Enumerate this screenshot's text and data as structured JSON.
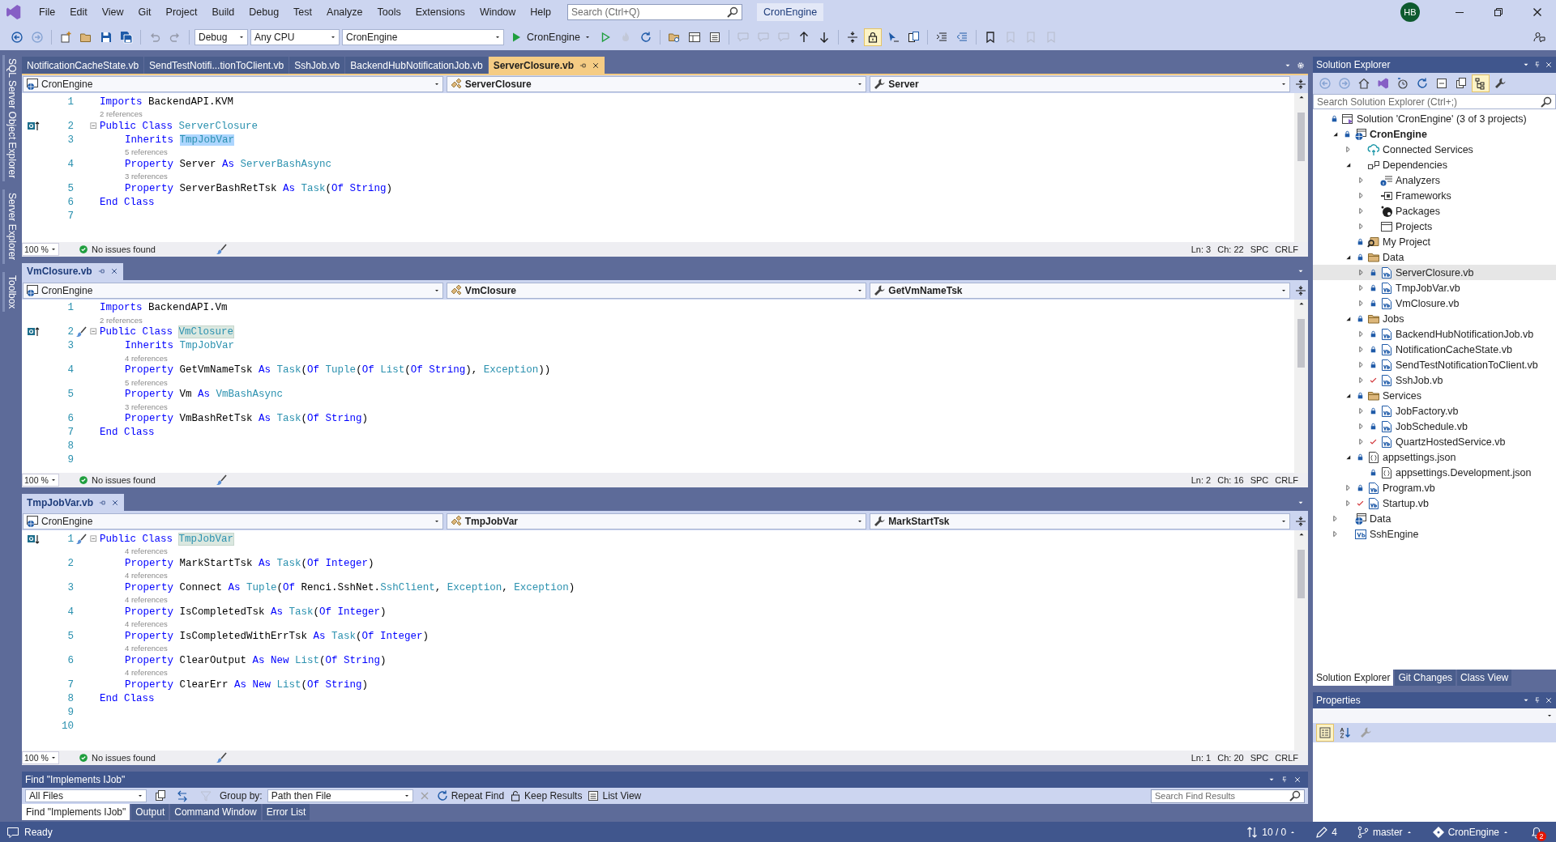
{
  "title_bar": {
    "menu": [
      "File",
      "Edit",
      "View",
      "Git",
      "Project",
      "Build",
      "Debug",
      "Test",
      "Analyze",
      "Tools",
      "Extensions",
      "Window",
      "Help"
    ],
    "search": {
      "placeholder": "Search (Ctrl+Q)"
    },
    "solution_name": "CronEngine",
    "account": {
      "initials": "HB"
    }
  },
  "toolbar": {
    "left_buttons": [
      {
        "disabled": false
      },
      {
        "disabled": true
      },
      {
        "disabled": false
      },
      {
        "disabled": false
      },
      {
        "disabled": false
      },
      {
        "disabled": false
      },
      {
        "disabled": true
      },
      {
        "disabled": true
      }
    ],
    "configuration": "Debug",
    "platform": "Any CPU",
    "startup_project": "CronEngine",
    "run_label": "CronEngine",
    "right_buttons": [
      {
        "pressed": false,
        "disabled": false
      },
      {
        "pressed": false,
        "disabled": true
      },
      {
        "pressed": false,
        "disabled": false
      },
      {
        "pressed": false,
        "disabled": false
      },
      {
        "pressed": false,
        "disabled": false
      },
      {
        "pressed": false,
        "disabled": false
      },
      {
        "pressed": false,
        "disabled": true
      },
      {
        "pressed": false,
        "disabled": true
      },
      {
        "pressed": false,
        "disabled": true
      },
      {
        "pressed": false,
        "disabled": false
      },
      {
        "pressed": false,
        "disabled": false
      },
      {
        "pressed": false,
        "disabled": false
      },
      {
        "pressed": true,
        "disabled": false
      },
      {
        "pressed": false,
        "disabled": false
      },
      {
        "pressed": false,
        "disabled": false
      },
      {
        "pressed": false,
        "disabled": false
      },
      {
        "pressed": false,
        "disabled": false
      },
      {
        "pressed": false,
        "disabled": false
      },
      {
        "pressed": false,
        "disabled": true
      },
      {
        "pressed": false,
        "disabled": true
      },
      {
        "pressed": false,
        "disabled": true
      }
    ]
  },
  "side_tabs": [
    "SQL Server Object Explorer",
    "Server Explorer",
    "Toolbox"
  ],
  "panes": [
    {
      "focused": true,
      "tabs": [
        {
          "label": "NotificationCacheState.vb",
          "selected": false
        },
        {
          "label": "SendTestNotifi...tionToClient.vb",
          "selected": false
        },
        {
          "label": "SshJob.vb",
          "selected": false
        },
        {
          "label": "BackendHubNotificationJob.vb",
          "selected": false
        },
        {
          "label": "ServerClosure.vb",
          "selected": true
        }
      ],
      "nav": {
        "project": "CronEngine",
        "type": "ServerClosure",
        "member": "Server"
      },
      "lines": [
        {
          "number": "1",
          "kind": "top",
          "tokens": [
            {
              "kind": "kw",
              "text": "Imports "
            },
            {
              "kind": "plain",
              "text": "BackendAPI.KVM"
            }
          ]
        },
        {
          "number": "2",
          "kind": "top",
          "codelens": "2 references",
          "glyph": {
            "kind": "up"
          },
          "fold": true,
          "tokens": [
            {
              "kind": "kw",
              "text": "Public Class "
            },
            {
              "kind": "type",
              "text": "ServerClosure"
            }
          ]
        },
        {
          "number": "3",
          "kind": "member",
          "tokens": [
            {
              "kind": "kw",
              "text": "Inherits "
            },
            {
              "kind": "type-selected",
              "text": "TmpJobVar"
            }
          ]
        },
        {
          "number": "4",
          "kind": "member",
          "codelens": "5 references",
          "tokens": [
            {
              "kind": "kw",
              "text": "Property "
            },
            {
              "kind": "plain",
              "text": "Server "
            },
            {
              "kind": "kw",
              "text": "As "
            },
            {
              "kind": "type",
              "text": "ServerBashAsync"
            }
          ]
        },
        {
          "number": "5",
          "kind": "member",
          "codelens": "3 references",
          "tokens": [
            {
              "kind": "kw",
              "text": "Property "
            },
            {
              "kind": "plain",
              "text": "ServerBashRetTsk "
            },
            {
              "kind": "kw",
              "text": "As "
            },
            {
              "kind": "type",
              "text": "Task"
            },
            {
              "kind": "plain",
              "text": "("
            },
            {
              "kind": "kw",
              "text": "Of String"
            },
            {
              "kind": "plain",
              "text": ")"
            }
          ]
        },
        {
          "number": "6",
          "kind": "top",
          "tokens": [
            {
              "kind": "kw",
              "text": "End Class"
            }
          ]
        },
        {
          "number": "7",
          "kind": "top"
        }
      ],
      "status": {
        "zoom": "100 %",
        "issues": "No issues found",
        "line": "Ln: 3",
        "column": "Ch: 22",
        "whitespace": "SPC",
        "line_ending": "CRLF"
      }
    },
    {
      "focused": false,
      "tabs": [
        {
          "label": "VmClosure.vb",
          "selected": true
        }
      ],
      "nav": {
        "project": "CronEngine",
        "type": "VmClosure",
        "member": "GetVmNameTsk"
      },
      "lines": [
        {
          "number": "1",
          "kind": "top",
          "tokens": [
            {
              "kind": "kw",
              "text": "Imports "
            },
            {
              "kind": "plain",
              "text": "BackendAPI.Vm"
            }
          ]
        },
        {
          "number": "2",
          "kind": "top",
          "codelens": "2 references",
          "glyph": {
            "kind": "up"
          },
          "quick_action": true,
          "fold": true,
          "tokens": [
            {
              "kind": "kw",
              "text": "Public Class "
            },
            {
              "kind": "type-ref",
              "text": "VmClosure"
            }
          ]
        },
        {
          "number": "3",
          "kind": "member",
          "tokens": [
            {
              "kind": "kw",
              "text": "Inherits "
            },
            {
              "kind": "type",
              "text": "TmpJobVar"
            }
          ]
        },
        {
          "number": "4",
          "kind": "member",
          "codelens": "4 references",
          "tokens": [
            {
              "kind": "kw",
              "text": "Property "
            },
            {
              "kind": "plain",
              "text": "GetVmNameTsk "
            },
            {
              "kind": "kw",
              "text": "As "
            },
            {
              "kind": "type",
              "text": "Task"
            },
            {
              "kind": "plain",
              "text": "("
            },
            {
              "kind": "kw",
              "text": "Of "
            },
            {
              "kind": "type",
              "text": "Tuple"
            },
            {
              "kind": "plain",
              "text": "("
            },
            {
              "kind": "kw",
              "text": "Of "
            },
            {
              "kind": "type",
              "text": "List"
            },
            {
              "kind": "plain",
              "text": "("
            },
            {
              "kind": "kw",
              "text": "Of String"
            },
            {
              "kind": "plain",
              "text": "), "
            },
            {
              "kind": "type",
              "text": "Exception"
            },
            {
              "kind": "plain",
              "text": "))"
            }
          ]
        },
        {
          "number": "5",
          "kind": "member",
          "codelens": "5 references",
          "tokens": [
            {
              "kind": "kw",
              "text": "Property "
            },
            {
              "kind": "plain",
              "text": "Vm "
            },
            {
              "kind": "kw",
              "text": "As "
            },
            {
              "kind": "type",
              "text": "VmBashAsync"
            }
          ]
        },
        {
          "number": "6",
          "kind": "member",
          "codelens": "3 references",
          "tokens": [
            {
              "kind": "kw",
              "text": "Property "
            },
            {
              "kind": "plain",
              "text": "VmBashRetTsk "
            },
            {
              "kind": "kw",
              "text": "As "
            },
            {
              "kind": "type",
              "text": "Task"
            },
            {
              "kind": "plain",
              "text": "("
            },
            {
              "kind": "kw",
              "text": "Of String"
            },
            {
              "kind": "plain",
              "text": ")"
            }
          ]
        },
        {
          "number": "7",
          "kind": "top",
          "tokens": [
            {
              "kind": "kw",
              "text": "End Class"
            }
          ]
        },
        {
          "number": "8",
          "kind": "top"
        },
        {
          "number": "9",
          "kind": "top"
        }
      ],
      "status": {
        "zoom": "100 %",
        "issues": "No issues found",
        "line": "Ln: 2",
        "column": "Ch: 16",
        "whitespace": "SPC",
        "line_ending": "CRLF"
      }
    },
    {
      "focused": false,
      "tabs": [
        {
          "label": "TmpJobVar.vb",
          "selected": true
        }
      ],
      "nav": {
        "project": "CronEngine",
        "type": "TmpJobVar",
        "member": "MarkStartTsk"
      },
      "lines": [
        {
          "number": "1",
          "kind": "top",
          "glyph": {
            "kind": "down"
          },
          "quick_action": true,
          "fold": true,
          "tokens": [
            {
              "kind": "kw",
              "text": "Public Class "
            },
            {
              "kind": "type-ref",
              "text": "TmpJobVar"
            }
          ]
        },
        {
          "number": "2",
          "kind": "member",
          "codelens": "4 references",
          "tokens": [
            {
              "kind": "kw",
              "text": "Property "
            },
            {
              "kind": "plain",
              "text": "MarkStartTsk "
            },
            {
              "kind": "kw",
              "text": "As "
            },
            {
              "kind": "type",
              "text": "Task"
            },
            {
              "kind": "plain",
              "text": "("
            },
            {
              "kind": "kw",
              "text": "Of Integer"
            },
            {
              "kind": "plain",
              "text": ")"
            }
          ]
        },
        {
          "number": "3",
          "kind": "member",
          "codelens": "4 references",
          "tokens": [
            {
              "kind": "kw",
              "text": "Property "
            },
            {
              "kind": "plain",
              "text": "Connect "
            },
            {
              "kind": "kw",
              "text": "As "
            },
            {
              "kind": "type",
              "text": "Tuple"
            },
            {
              "kind": "plain",
              "text": "("
            },
            {
              "kind": "kw",
              "text": "Of "
            },
            {
              "kind": "plain",
              "text": "Renci.SshNet."
            },
            {
              "kind": "type",
              "text": "SshClient"
            },
            {
              "kind": "plain",
              "text": ", "
            },
            {
              "kind": "type",
              "text": "Exception"
            },
            {
              "kind": "plain",
              "text": ", "
            },
            {
              "kind": "type",
              "text": "Exception"
            },
            {
              "kind": "plain",
              "text": ")"
            }
          ]
        },
        {
          "number": "4",
          "kind": "member",
          "codelens": "4 references",
          "tokens": [
            {
              "kind": "kw",
              "text": "Property "
            },
            {
              "kind": "plain",
              "text": "IsCompletedTsk "
            },
            {
              "kind": "kw",
              "text": "As "
            },
            {
              "kind": "type",
              "text": "Task"
            },
            {
              "kind": "plain",
              "text": "("
            },
            {
              "kind": "kw",
              "text": "Of Integer"
            },
            {
              "kind": "plain",
              "text": ")"
            }
          ]
        },
        {
          "number": "5",
          "kind": "member",
          "codelens": "4 references",
          "tokens": [
            {
              "kind": "kw",
              "text": "Property "
            },
            {
              "kind": "plain",
              "text": "IsCompletedWithErrTsk "
            },
            {
              "kind": "kw",
              "text": "As "
            },
            {
              "kind": "type",
              "text": "Task"
            },
            {
              "kind": "plain",
              "text": "("
            },
            {
              "kind": "kw",
              "text": "Of Integer"
            },
            {
              "kind": "plain",
              "text": ")"
            }
          ]
        },
        {
          "number": "6",
          "kind": "member",
          "codelens": "4 references",
          "tokens": [
            {
              "kind": "kw",
              "text": "Property "
            },
            {
              "kind": "plain",
              "text": "ClearOutput "
            },
            {
              "kind": "kw",
              "text": "As New "
            },
            {
              "kind": "type",
              "text": "List"
            },
            {
              "kind": "plain",
              "text": "("
            },
            {
              "kind": "kw",
              "text": "Of String"
            },
            {
              "kind": "plain",
              "text": ")"
            }
          ]
        },
        {
          "number": "7",
          "kind": "member",
          "codelens": "4 references",
          "tokens": [
            {
              "kind": "kw",
              "text": "Property "
            },
            {
              "kind": "plain",
              "text": "ClearErr "
            },
            {
              "kind": "kw",
              "text": "As New "
            },
            {
              "kind": "type",
              "text": "List"
            },
            {
              "kind": "plain",
              "text": "("
            },
            {
              "kind": "kw",
              "text": "Of String"
            },
            {
              "kind": "plain",
              "text": ")"
            }
          ]
        },
        {
          "number": "8",
          "kind": "top",
          "tokens": [
            {
              "kind": "kw",
              "text": "End Class"
            }
          ]
        },
        {
          "number": "9",
          "kind": "top"
        },
        {
          "number": "10",
          "kind": "top"
        }
      ],
      "status": {
        "zoom": "100 %",
        "issues": "No issues found",
        "line": "Ln: 1",
        "column": "Ch: 20",
        "whitespace": "SPC",
        "line_ending": "CRLF"
      }
    }
  ],
  "find_panel": {
    "title": "Find \"Implements IJob\"",
    "scope": "All Files",
    "group_by_label": "Group by:",
    "group_by": "Path then File",
    "repeat_find": "Repeat Find",
    "keep_results": "Keep Results",
    "list_view": "List View",
    "search": {
      "placeholder": "Search Find Results"
    },
    "tabs": [
      {
        "label": "Find \"Implements IJob\"",
        "selected": true
      },
      {
        "label": "Output",
        "selected": false
      },
      {
        "label": "Command Window",
        "selected": false
      },
      {
        "label": "Error List",
        "selected": false
      }
    ]
  },
  "solution_explorer": {
    "title": "Solution Explorer",
    "toolbar": [
      {
        "pressed": false,
        "disabled": true
      },
      {
        "pressed": false,
        "disabled": true
      },
      {
        "pressed": false,
        "disabled": false
      },
      {
        "pressed": false,
        "disabled": false
      },
      {
        "pressed": false,
        "disabled": false
      },
      {
        "pressed": false,
        "disabled": false
      },
      {
        "pressed": false,
        "disabled": false
      },
      {
        "pressed": false,
        "disabled": false
      },
      {
        "pressed": true,
        "disabled": false
      },
      {
        "pressed": false,
        "disabled": false
      }
    ],
    "search": {
      "placeholder": "Search Solution Explorer (Ctrl+;)"
    },
    "tree": [
      {
        "label": "Solution 'CronEngine' (3 of 3 projects)",
        "kind": "solution",
        "vcs": {
          "kind": "locked"
        },
        "selected": false,
        "children": [
          {
            "label": "CronEngine",
            "kind": "web-project",
            "vcs": {
              "kind": "locked"
            },
            "startup": true,
            "expanded": true,
            "selected": false,
            "children": [
              {
                "label": "Connected Services",
                "kind": "connected",
                "expanded": false,
                "selected": false
              },
              {
                "label": "Dependencies",
                "kind": "dependencies",
                "expanded": true,
                "selected": false,
                "children": [
                  {
                    "label": "Analyzers",
                    "kind": "analyzers",
                    "expanded": false,
                    "selected": false
                  },
                  {
                    "label": "Frameworks",
                    "kind": "frameworks",
                    "expanded": false,
                    "selected": false
                  },
                  {
                    "label": "Packages",
                    "kind": "packages",
                    "expanded": false,
                    "selected": false
                  },
                  {
                    "label": "Projects",
                    "kind": "projects",
                    "expanded": false,
                    "selected": false
                  }
                ]
              },
              {
                "label": "My Project",
                "kind": "my-project",
                "vcs": {
                  "kind": "locked"
                },
                "selected": false
              },
              {
                "label": "Data",
                "kind": "folder",
                "vcs": {
                  "kind": "locked"
                },
                "expanded": true,
                "selected": false,
                "children": [
                  {
                    "label": "ServerClosure.vb",
                    "kind": "vb",
                    "vcs": {
                      "kind": "locked"
                    },
                    "expanded": false,
                    "selected": true
                  },
                  {
                    "label": "TmpJobVar.vb",
                    "kind": "vb",
                    "vcs": {
                      "kind": "locked"
                    },
                    "expanded": false,
                    "selected": false
                  },
                  {
                    "label": "VmClosure.vb",
                    "kind": "vb",
                    "vcs": {
                      "kind": "locked"
                    },
                    "expanded": false,
                    "selected": false
                  }
                ]
              },
              {
                "label": "Jobs",
                "kind": "folder",
                "vcs": {
                  "kind": "locked"
                },
                "expanded": true,
                "selected": false,
                "children": [
                  {
                    "label": "BackendHubNotificationJob.vb",
                    "kind": "vb",
                    "vcs": {
                      "kind": "locked"
                    },
                    "expanded": false,
                    "selected": false
                  },
                  {
                    "label": "NotificationCacheState.vb",
                    "kind": "vb",
                    "vcs": {
                      "kind": "locked"
                    },
                    "expanded": false,
                    "selected": false
                  },
                  {
                    "label": "SendTestNotificationToClient.vb",
                    "kind": "vb",
                    "vcs": {
                      "kind": "locked"
                    },
                    "expanded": false,
                    "selected": false
                  },
                  {
                    "label": "SshJob.vb",
                    "kind": "vb",
                    "vcs": {
                      "kind": "modified"
                    },
                    "expanded": false,
                    "selected": false
                  }
                ]
              },
              {
                "label": "Services",
                "kind": "folder",
                "vcs": {
                  "kind": "locked"
                },
                "expanded": true,
                "selected": false,
                "children": [
                  {
                    "label": "JobFactory.vb",
                    "kind": "vb",
                    "vcs": {
                      "kind": "locked"
                    },
                    "expanded": false,
                    "selected": false
                  },
                  {
                    "label": "JobSchedule.vb",
                    "kind": "vb",
                    "vcs": {
                      "kind": "locked"
                    },
                    "expanded": false,
                    "selected": false
                  },
                  {
                    "label": "QuartzHostedService.vb",
                    "kind": "vb",
                    "vcs": {
                      "kind": "modified"
                    },
                    "expanded": false,
                    "selected": false
                  }
                ]
              },
              {
                "label": "appsettings.json",
                "kind": "json",
                "vcs": {
                  "kind": "locked"
                },
                "expanded": true,
                "selected": false,
                "children": [
                  {
                    "label": "appsettings.Development.json",
                    "kind": "json",
                    "vcs": {
                      "kind": "locked"
                    },
                    "selected": false
                  }
                ]
              },
              {
                "label": "Program.vb",
                "kind": "vb",
                "vcs": {
                  "kind": "locked"
                },
                "expanded": false,
                "selected": false
              },
              {
                "label": "Startup.vb",
                "kind": "vb",
                "vcs": {
                  "kind": "modified"
                },
                "expanded": false,
                "selected": false
              }
            ]
          },
          {
            "label": "Data",
            "kind": "web-project",
            "startup": false,
            "expanded": false,
            "selected": false
          },
          {
            "label": "SshEngine",
            "kind": "vb-project",
            "startup": false,
            "expanded": false,
            "selected": false
          }
        ]
      }
    ],
    "tabs": [
      {
        "label": "Solution Explorer",
        "selected": true
      },
      {
        "label": "Git Changes",
        "selected": false
      },
      {
        "label": "Class View",
        "selected": false
      }
    ]
  },
  "properties": {
    "title": "Properties",
    "toolbar": [
      {
        "pressed": true
      },
      {
        "pressed": false
      },
      {
        "pressed": false
      }
    ]
  },
  "status_bar": {
    "message": "Ready",
    "sync": "10 / 0",
    "changes": "4",
    "branch": "master",
    "repository": "CronEngine",
    "notifications": "2"
  }
}
